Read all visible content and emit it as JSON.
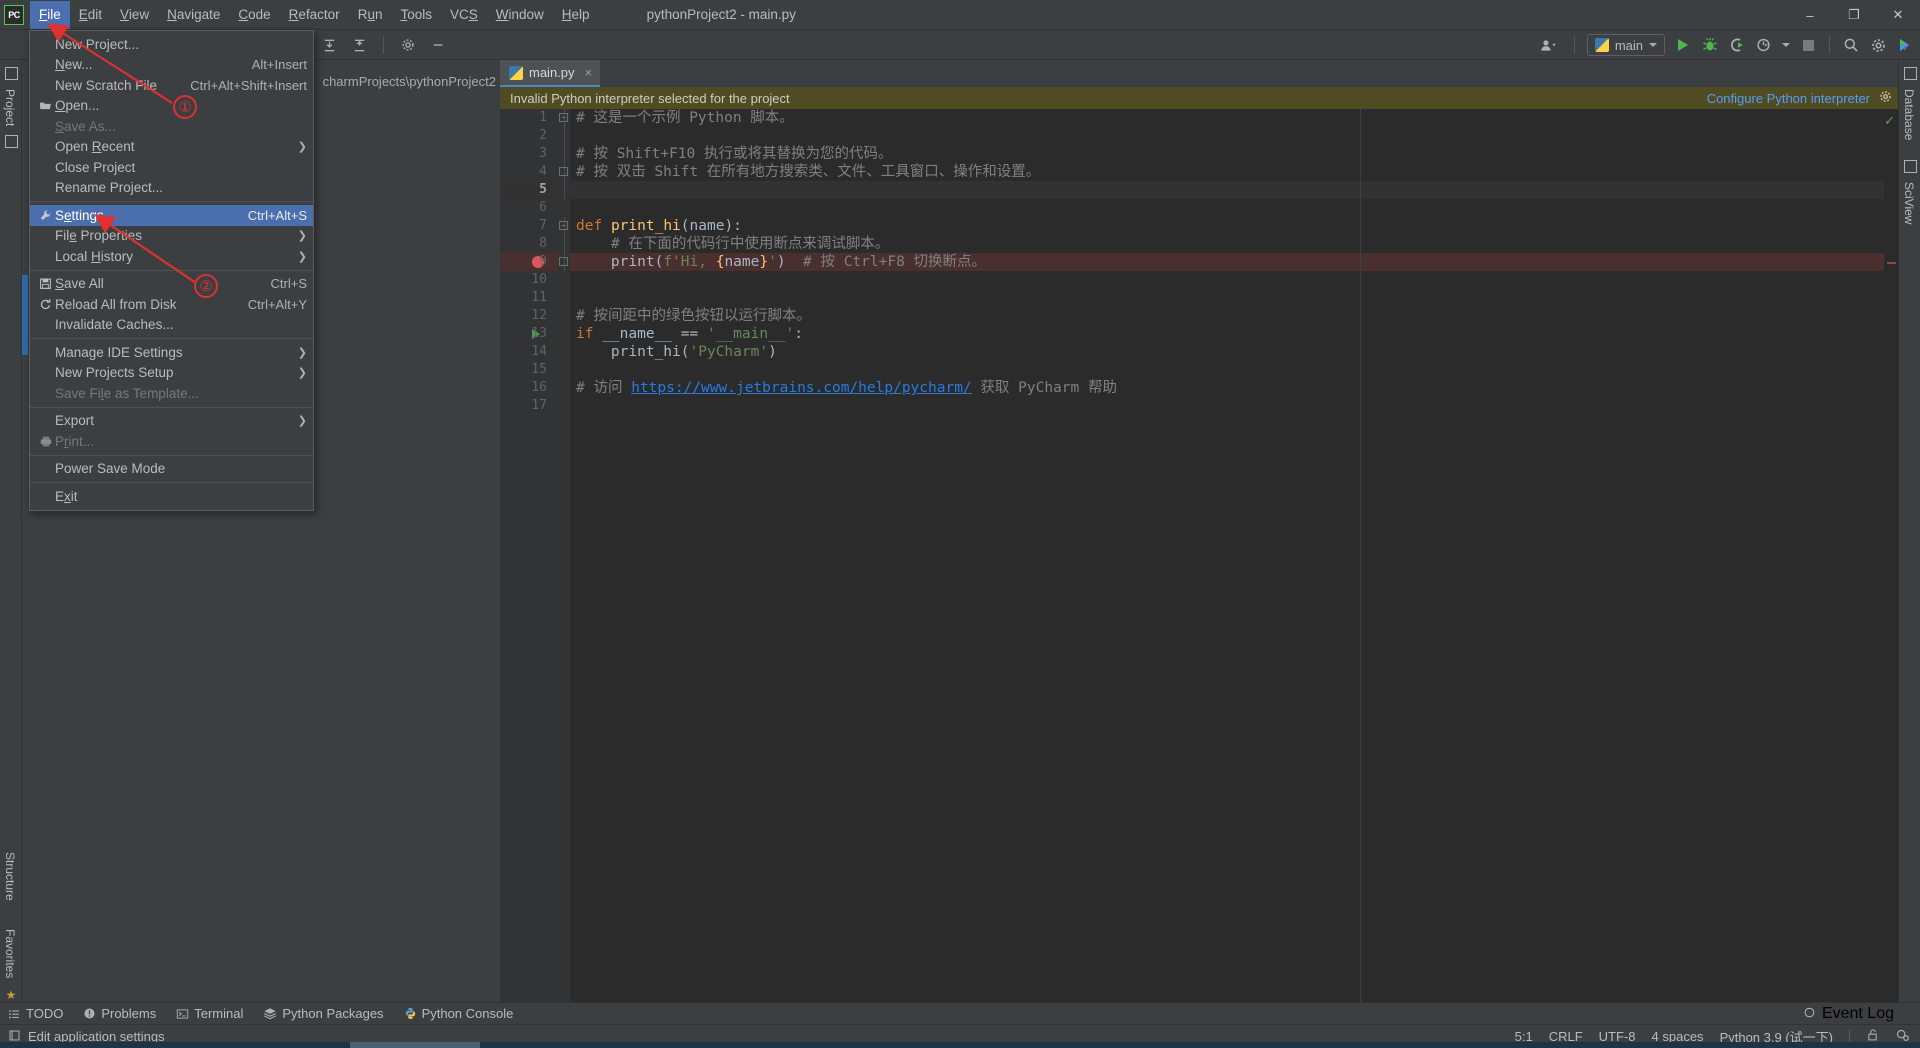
{
  "window": {
    "title": "pythonProject2 - main.py",
    "logo_text": "PC",
    "minimize": "–",
    "maximize": "❐",
    "close": "✕"
  },
  "menubar": {
    "items": [
      {
        "label": "File",
        "active": true
      },
      {
        "label": "Edit",
        "active": false
      },
      {
        "label": "View",
        "active": false
      },
      {
        "label": "Navigate",
        "active": false
      },
      {
        "label": "Code",
        "active": false
      },
      {
        "label": "Refactor",
        "active": false
      },
      {
        "label": "Run",
        "active": false
      },
      {
        "label": "Tools",
        "active": false
      },
      {
        "label": "VCS",
        "active": false
      },
      {
        "label": "Window",
        "active": false
      },
      {
        "label": "Help",
        "active": false
      }
    ]
  },
  "file_menu": {
    "groups": [
      [
        {
          "label": "New Project...",
          "shortcut": "",
          "icon": "",
          "state": "normal",
          "submenu": false
        },
        {
          "label": "New...",
          "shortcut": "Alt+Insert",
          "icon": "",
          "state": "normal",
          "submenu": false
        },
        {
          "label": "New Scratch File",
          "shortcut": "Ctrl+Alt+Shift+Insert",
          "icon": "",
          "state": "normal",
          "submenu": false
        },
        {
          "label": "Open...",
          "shortcut": "",
          "icon": "folder-icon",
          "state": "normal",
          "submenu": false
        },
        {
          "label": "Save As...",
          "shortcut": "",
          "icon": "",
          "state": "disabled",
          "submenu": false
        },
        {
          "label": "Open Recent",
          "shortcut": "",
          "icon": "",
          "state": "normal",
          "submenu": true
        },
        {
          "label": "Close Project",
          "shortcut": "",
          "icon": "",
          "state": "normal",
          "submenu": false
        },
        {
          "label": "Rename Project...",
          "shortcut": "",
          "icon": "",
          "state": "normal",
          "submenu": false
        }
      ],
      [
        {
          "label": "Settings...",
          "shortcut": "Ctrl+Alt+S",
          "icon": "wrench-icon",
          "state": "selected",
          "submenu": false
        },
        {
          "label": "File Properties",
          "shortcut": "",
          "icon": "",
          "state": "normal",
          "submenu": true
        },
        {
          "label": "Local History",
          "shortcut": "",
          "icon": "",
          "state": "normal",
          "submenu": true
        }
      ],
      [
        {
          "label": "Save All",
          "shortcut": "Ctrl+S",
          "icon": "save-icon",
          "state": "normal",
          "submenu": false
        },
        {
          "label": "Reload All from Disk",
          "shortcut": "Ctrl+Alt+Y",
          "icon": "reload-icon",
          "state": "normal",
          "submenu": false
        },
        {
          "label": "Invalidate Caches...",
          "shortcut": "",
          "icon": "",
          "state": "normal",
          "submenu": false
        }
      ],
      [
        {
          "label": "Manage IDE Settings",
          "shortcut": "",
          "icon": "",
          "state": "normal",
          "submenu": true
        },
        {
          "label": "New Projects Setup",
          "shortcut": "",
          "icon": "",
          "state": "normal",
          "submenu": true
        },
        {
          "label": "Save File as Template...",
          "shortcut": "",
          "icon": "",
          "state": "disabled",
          "submenu": false
        }
      ],
      [
        {
          "label": "Export",
          "shortcut": "",
          "icon": "",
          "state": "normal",
          "submenu": true
        },
        {
          "label": "Print...",
          "shortcut": "",
          "icon": "printer-icon",
          "state": "disabled",
          "submenu": false
        }
      ],
      [
        {
          "label": "Power Save Mode",
          "shortcut": "",
          "icon": "",
          "state": "normal",
          "submenu": false
        }
      ],
      [
        {
          "label": "Exit",
          "shortcut": "",
          "icon": "",
          "state": "normal",
          "submenu": false
        }
      ]
    ]
  },
  "annotations": {
    "marker_one": "①",
    "marker_two": "②",
    "accent_color": "#e03030"
  },
  "left_strip": {
    "project_label": "Project",
    "structure_label": "Structure",
    "favorites_label": "Favorites"
  },
  "right_strip": {
    "database_label": "Database",
    "sciview_label": "SciView"
  },
  "project_panel": {
    "path": "charmProjects\\pythonProject2"
  },
  "toolbar": {
    "run_config": "main",
    "icons": [
      "target-icon",
      "collapse-all-icon",
      "expand-all-icon",
      "gear-icon",
      "minimize-icon"
    ],
    "right_icons": [
      "user-icon",
      "run-icon",
      "debug-icon",
      "run-coverage-icon",
      "profile-icon",
      "stop-icon",
      "search-icon",
      "settings-gear-icon",
      "updates-icon"
    ]
  },
  "editor": {
    "tab": {
      "name": "main.py",
      "close": "×",
      "icon": "python-file-icon"
    },
    "notification": {
      "message": "Invalid Python interpreter selected for the project",
      "action": "Configure Python interpreter",
      "gear": "gear-icon"
    },
    "lines": [
      {
        "n": 1,
        "fold": "start",
        "html": "<span class=\"c-comment\"># 这是一个示例 Python 脚本。</span>"
      },
      {
        "n": 2,
        "fold": "",
        "html": ""
      },
      {
        "n": 3,
        "fold": "",
        "html": "<span class=\"c-comment\"># 按 Shift+F10 执行或将其替换为您的代码。</span>"
      },
      {
        "n": 4,
        "fold": "end",
        "html": "<span class=\"c-comment\"># 按 双击 Shift 在所有地方搜索类、文件、工具窗口、操作和设置。</span>"
      },
      {
        "n": 5,
        "fold": "",
        "html": "",
        "current": true
      },
      {
        "n": 6,
        "fold": "",
        "html": ""
      },
      {
        "n": 7,
        "fold": "start",
        "html": "<span class=\"c-kw\">def</span> <span class=\"c-fn\">print_hi</span>(<span class=\"c-ident\">name</span>):"
      },
      {
        "n": 8,
        "fold": "",
        "html": "    <span class=\"c-comment\"># 在下面的代码行中使用断点来调试脚本。</span>"
      },
      {
        "n": 9,
        "fold": "end",
        "breakpoint": true,
        "html": "    <span class=\"c-ident\">print</span>(<span class=\"c-str\">f'Hi, </span><span class=\"c-brace\">{</span><span class=\"c-ident\">name</span><span class=\"c-brace\">}</span><span class=\"c-str\">'</span>)  <span class=\"c-comment\"># 按 Ctrl+F8 切换断点。</span>"
      },
      {
        "n": 10,
        "fold": "",
        "html": ""
      },
      {
        "n": 11,
        "fold": "",
        "html": ""
      },
      {
        "n": 12,
        "fold": "",
        "html": "<span class=\"c-comment\"># 按间距中的绿色按钮以运行脚本。</span>"
      },
      {
        "n": 13,
        "fold": "",
        "runmark": true,
        "html": "<span class=\"c-kw\">if</span> <span class=\"c-ident\">__name__</span> == <span class=\"c-str\">'__main__'</span>:"
      },
      {
        "n": 14,
        "fold": "",
        "html": "    <span class=\"c-ident\">print_hi</span>(<span class=\"c-str\">'PyCharm'</span>)"
      },
      {
        "n": 15,
        "fold": "",
        "html": ""
      },
      {
        "n": 16,
        "fold": "",
        "html": "<span class=\"c-comment\"># 访问 </span><span class=\"c-link\">https://www.jetbrains.com/help/pycharm/</span><span class=\"c-comment\"> 获取 PyCharm 帮助</span>"
      },
      {
        "n": 17,
        "fold": "",
        "html": ""
      }
    ],
    "inspection_ok": "✓"
  },
  "bottom_bar": {
    "items": [
      {
        "label": "TODO",
        "icon": "list-icon"
      },
      {
        "label": "Problems",
        "icon": "exclamation-circle-icon"
      },
      {
        "label": "Terminal",
        "icon": "terminal-icon"
      },
      {
        "label": "Python Packages",
        "icon": "packages-icon"
      },
      {
        "label": "Python Console",
        "icon": "python-icon"
      }
    ],
    "event_log": {
      "label": "Event Log",
      "icon": "balloon-icon"
    }
  },
  "status_bar": {
    "hint": "Edit application settings",
    "hint_icon": "window-icon",
    "caret": "5:1",
    "line_sep": "CRLF",
    "encoding": "UTF-8",
    "indent": "4 spaces",
    "interpreter": "Python 3.9 (试一下)",
    "lock_icon": "unlocked-icon",
    "inspection_icon": "inspection-icon"
  }
}
